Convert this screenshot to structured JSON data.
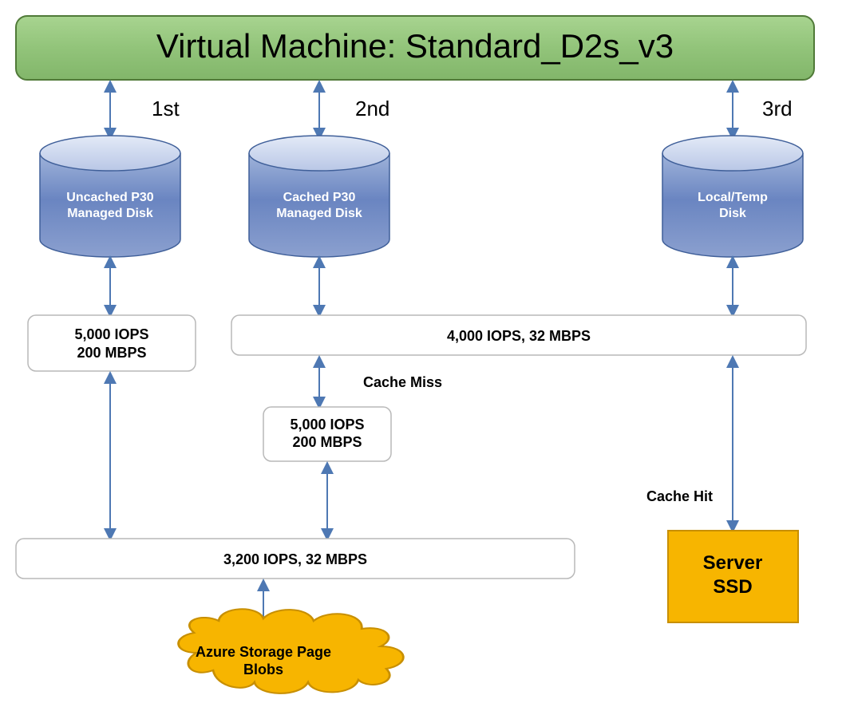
{
  "vm": {
    "title": "Virtual Machine: Standard_D2s_v3"
  },
  "labels": {
    "path1": "1st",
    "path2": "2nd",
    "path3": "3rd"
  },
  "disks": {
    "uncached": {
      "line1": "Uncached P30",
      "line2": "Managed Disk"
    },
    "cached": {
      "line1": "Cached P30",
      "line2": "Managed Disk"
    },
    "local": {
      "line1": "Local/Temp",
      "line2": "Disk"
    }
  },
  "boxes": {
    "uncached_cap": {
      "line1": "5,000 IOPS",
      "line2": "200 MBPS"
    },
    "vm_cap_cached": "4,000 IOPS, 32 MBPS",
    "cached_cap": {
      "line1": "5,000 IOPS",
      "line2": "200 MBPS"
    },
    "vm_cap_uncached": "3,200 IOPS, 32 MBPS"
  },
  "cache": {
    "miss": "Cache Miss",
    "hit": "Cache Hit"
  },
  "server_ssd": {
    "line1": "Server",
    "line2": "SSD"
  },
  "storage": {
    "line1": "Azure Storage Page",
    "line2": "Blobs"
  },
  "colors": {
    "vm_fill": "#92c47a",
    "vm_stroke": "#507a38",
    "disk_top": "#cfd9ef",
    "disk_mid1": "#9fb3da",
    "disk_mid2": "#6a85c1",
    "disk_bot": "#7d97ca",
    "disk_stroke": "#3f5f99",
    "arrow": "#4e78b3",
    "box_stroke": "#b9b9b9",
    "gold": "#f7b500",
    "gold_stroke": "#c88f00",
    "text_white": "#ffffff",
    "text_dark": "#000000"
  }
}
